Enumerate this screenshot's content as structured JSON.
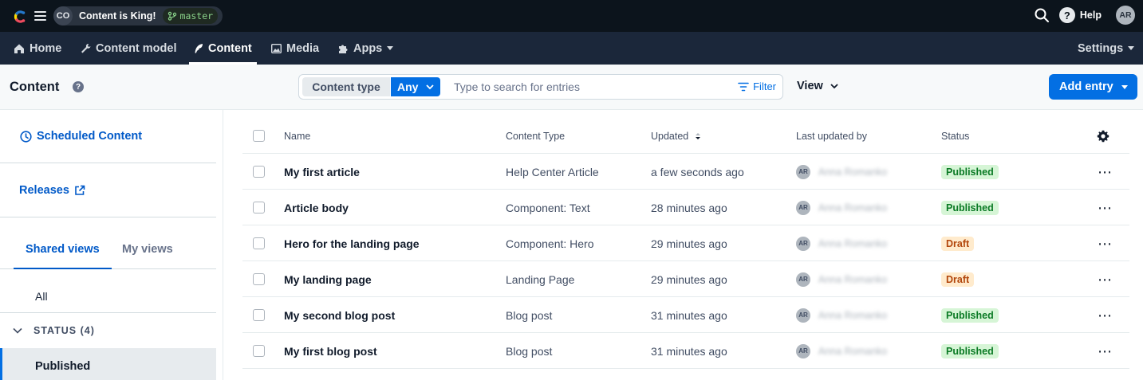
{
  "topbar": {
    "space_initials": "CO",
    "space_name": "Content is King!",
    "environment": "master",
    "help_label": "Help",
    "user_initials": "AR"
  },
  "nav": {
    "items": [
      {
        "label": "Home",
        "icon": "home-icon"
      },
      {
        "label": "Content model",
        "icon": "wrench-icon"
      },
      {
        "label": "Content",
        "icon": "feather-icon",
        "active": true
      },
      {
        "label": "Media",
        "icon": "image-icon"
      },
      {
        "label": "Apps",
        "icon": "puzzle-icon"
      }
    ],
    "settings_label": "Settings"
  },
  "header": {
    "title": "Content",
    "content_type_label": "Content type",
    "content_type_value": "Any",
    "search_placeholder": "Type to search for entries",
    "filter_label": "Filter",
    "view_label": "View",
    "add_entry_label": "Add entry"
  },
  "sidebar": {
    "scheduled_label": "Scheduled Content",
    "releases_label": "Releases",
    "tabs": [
      "Shared views",
      "My views"
    ],
    "all_label": "All",
    "status_group_label": "STATUS (4)",
    "selected_view": "Published"
  },
  "table": {
    "columns": [
      "Name",
      "Content Type",
      "Updated",
      "Last updated by",
      "Status"
    ],
    "rows": [
      {
        "name": "My first article",
        "type": "Help Center Article",
        "updated": "a few seconds ago",
        "by_initials": "AR",
        "by_name": "Anna Romanko",
        "status": "Published"
      },
      {
        "name": "Article body",
        "type": "Component: Text",
        "updated": "28 minutes ago",
        "by_initials": "AR",
        "by_name": "Anna Romanko",
        "status": "Published"
      },
      {
        "name": "Hero for the landing page",
        "type": "Component: Hero",
        "updated": "29 minutes ago",
        "by_initials": "AR",
        "by_name": "Anna Romanko",
        "status": "Draft"
      },
      {
        "name": "My landing page",
        "type": "Landing Page",
        "updated": "29 minutes ago",
        "by_initials": "AR",
        "by_name": "Anna Romanko",
        "status": "Draft"
      },
      {
        "name": "My second blog post",
        "type": "Blog post",
        "updated": "31 minutes ago",
        "by_initials": "AR",
        "by_name": "Anna Romanko",
        "status": "Published"
      },
      {
        "name": "My first blog post",
        "type": "Blog post",
        "updated": "31 minutes ago",
        "by_initials": "AR",
        "by_name": "Anna Romanko",
        "status": "Published"
      }
    ]
  },
  "colors": {
    "topbar": "#0c141c",
    "navbar": "#1b273a",
    "primary": "#036fe3",
    "published_bg": "#d6f5d6",
    "draft_bg": "#ffebcd"
  }
}
